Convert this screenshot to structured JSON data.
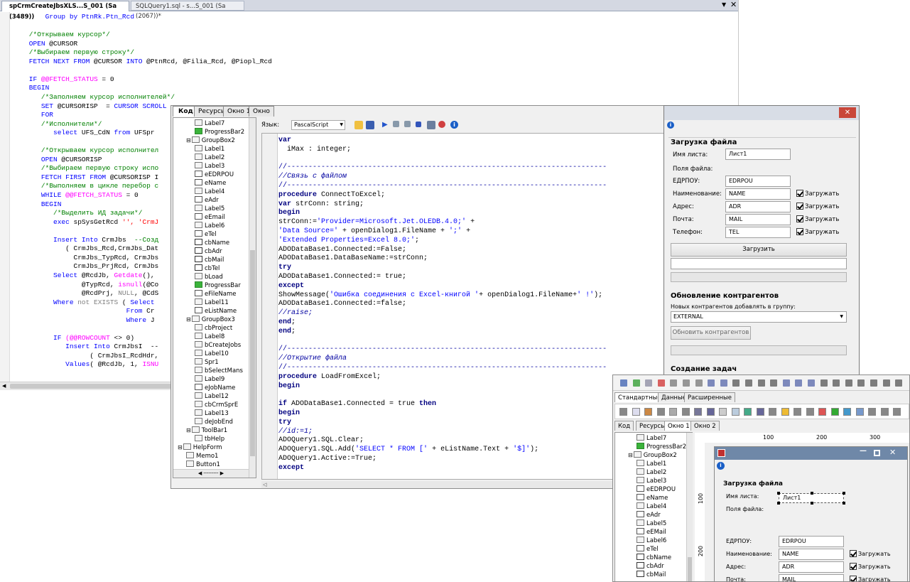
{
  "sql": {
    "tab1": "spCrmCreateJbsXLS...S_001 (Sa (3489))",
    "tab2": "SQLQuery1.sql - s...S_001 (Sa (2067))*",
    "lines": [
      [
        [
          "        Group by PtnRk.Ptn_Rcd",
          "k"
        ]
      ],
      [
        [
          "",
          ""
        ]
      ],
      [
        [
          "    /*Открываем курсор*/",
          "c"
        ]
      ],
      [
        [
          "    OPEN",
          "k"
        ],
        [
          " @CURSOR",
          "n"
        ]
      ],
      [
        [
          "    /*Выбираем первую строку*/",
          "c"
        ]
      ],
      [
        [
          "    FETCH NEXT FROM",
          "k"
        ],
        [
          " @CURSOR ",
          "n"
        ],
        [
          "INTO",
          "k"
        ],
        [
          " @PtnRcd, @Filia_Rcd, @Piopl_Rcd",
          "n"
        ]
      ],
      [
        [
          "",
          ""
        ]
      ],
      [
        [
          "    IF",
          "k"
        ],
        [
          " @@FETCH_STATUS",
          "m"
        ],
        [
          " = 0",
          "n"
        ]
      ],
      [
        [
          "    BEGIN",
          "k"
        ]
      ],
      [
        [
          "       /*Заполняем курсор исполнителей*/",
          "c"
        ]
      ],
      [
        [
          "       SET",
          "k"
        ],
        [
          " @CURSORISP  = ",
          "n"
        ],
        [
          "CURSOR SCROLL",
          "k"
        ]
      ],
      [
        [
          "       FOR",
          "k"
        ]
      ],
      [
        [
          "       /*Исполнители*/",
          "c"
        ]
      ],
      [
        [
          "          select",
          "k"
        ],
        [
          " UFS_CdN ",
          "n"
        ],
        [
          "from",
          "k"
        ],
        [
          " UFSpr",
          "n"
        ]
      ],
      [
        [
          "",
          ""
        ]
      ],
      [
        [
          "       /*Открываем курсор исполнител",
          "c"
        ]
      ],
      [
        [
          "       OPEN",
          "k"
        ],
        [
          " @CURSORISP",
          "n"
        ]
      ],
      [
        [
          "       /*Выбираем первую строку испо",
          "c"
        ]
      ],
      [
        [
          "       FETCH FIRST FROM",
          "k"
        ],
        [
          " @CURSORISP I",
          "n"
        ]
      ],
      [
        [
          "       /*Выполняем в цикле перебор с",
          "c"
        ]
      ],
      [
        [
          "       WHILE",
          "k"
        ],
        [
          " @@FETCH_STATUS",
          "m"
        ],
        [
          " = 0",
          "n"
        ]
      ],
      [
        [
          "       BEGIN",
          "k"
        ]
      ],
      [
        [
          "          /*Выделить ИД задачи*/",
          "c"
        ]
      ],
      [
        [
          "          exec",
          "k"
        ],
        [
          " spSysGetRcd ",
          "n"
        ],
        [
          "'', 'CrmJ",
          "s"
        ]
      ],
      [
        [
          "",
          ""
        ]
      ],
      [
        [
          "          Insert Into",
          "k"
        ],
        [
          " CrmJbs  ",
          "n"
        ],
        [
          "--Созд",
          "c"
        ]
      ],
      [
        [
          "             ( CrmJbs_Rcd,CrmJbs_Dat",
          "n"
        ]
      ],
      [
        [
          "               CrmJbs_TypRcd, CrmJbs",
          "n"
        ]
      ],
      [
        [
          "               CrmJbs_PrjRcd, CrmJbs",
          "n"
        ]
      ],
      [
        [
          "          Select",
          "k"
        ],
        [
          " @RcdJb, ",
          "n"
        ],
        [
          "Getdate",
          "m"
        ],
        [
          "(),",
          "n"
        ]
      ],
      [
        [
          "                 @TypRcd, ",
          "n"
        ],
        [
          "isnull",
          "m"
        ],
        [
          "(@Co",
          "n"
        ]
      ],
      [
        [
          "                 @RcdPrj, ",
          "n"
        ],
        [
          "NULL",
          "g"
        ],
        [
          ", @CdS",
          "n"
        ]
      ],
      [
        [
          "          Where",
          "k"
        ],
        [
          " not EXISTS",
          "g"
        ],
        [
          " ( ",
          "n"
        ],
        [
          "Select",
          "k"
        ]
      ],
      [
        [
          "                            From",
          "k"
        ],
        [
          " Cr",
          "n"
        ]
      ],
      [
        [
          "                            Where",
          "k"
        ],
        [
          " J",
          "n"
        ]
      ],
      [
        [
          "",
          ""
        ]
      ],
      [
        [
          "          IF",
          "k"
        ],
        [
          " (@@ROWCOUNT",
          "m"
        ],
        [
          " <> 0)",
          "n"
        ]
      ],
      [
        [
          "             Insert Into",
          "k"
        ],
        [
          " CrmJbsI  --",
          "n"
        ]
      ],
      [
        [
          "                   ( CrmJbsI_RcdHdr,",
          "n"
        ]
      ],
      [
        [
          "             Values",
          "k"
        ],
        [
          "( @RcdJb, 1, ",
          "n"
        ],
        [
          "ISNU",
          "m"
        ]
      ]
    ]
  },
  "ide": {
    "tabs": [
      "Код",
      "Ресурсы",
      "Окно 1",
      "Окно 2"
    ],
    "lang_label": "Язык:",
    "lang_value": "PascalScript",
    "tree": [
      {
        "t": "Label7",
        "d": 2,
        "i": "lbl"
      },
      {
        "t": "ProgressBar2",
        "d": 2,
        "i": "pb"
      },
      {
        "t": "GroupBox2",
        "d": 1,
        "i": "grp"
      },
      {
        "t": "Label1",
        "d": 2,
        "i": "lbl"
      },
      {
        "t": "Label2",
        "d": 2,
        "i": "lbl"
      },
      {
        "t": "Label3",
        "d": 2,
        "i": "lbl"
      },
      {
        "t": "eEDRPOU",
        "d": 2,
        "i": "ed"
      },
      {
        "t": "eName",
        "d": 2,
        "i": "ed"
      },
      {
        "t": "Label4",
        "d": 2,
        "i": "lbl"
      },
      {
        "t": "eAdr",
        "d": 2,
        "i": "ed"
      },
      {
        "t": "Label5",
        "d": 2,
        "i": "lbl"
      },
      {
        "t": "eEmail",
        "d": 2,
        "i": "ed"
      },
      {
        "t": "Label6",
        "d": 2,
        "i": "lbl"
      },
      {
        "t": "eTel",
        "d": 2,
        "i": "ed"
      },
      {
        "t": "cbName",
        "d": 2,
        "i": "cb"
      },
      {
        "t": "cbAdr",
        "d": 2,
        "i": "cb"
      },
      {
        "t": "cbMail",
        "d": 2,
        "i": "cb"
      },
      {
        "t": "cbTel",
        "d": 2,
        "i": "cb"
      },
      {
        "t": "bLoad",
        "d": 2,
        "i": "lbl"
      },
      {
        "t": "ProgressBar",
        "d": 2,
        "i": "pb"
      },
      {
        "t": "eFileName",
        "d": 2,
        "i": "ed"
      },
      {
        "t": "Label11",
        "d": 2,
        "i": "lbl"
      },
      {
        "t": "eListName",
        "d": 2,
        "i": "ed"
      },
      {
        "t": "GroupBox3",
        "d": 1,
        "i": "grp"
      },
      {
        "t": "cbProject",
        "d": 2,
        "i": "lbl"
      },
      {
        "t": "Label8",
        "d": 2,
        "i": "lbl"
      },
      {
        "t": "bCreateJobs",
        "d": 2,
        "i": "lbl"
      },
      {
        "t": "Label10",
        "d": 2,
        "i": "lbl"
      },
      {
        "t": "Spr1",
        "d": 2,
        "i": "lbl"
      },
      {
        "t": "bSelectMans",
        "d": 2,
        "i": "lbl"
      },
      {
        "t": "Label9",
        "d": 2,
        "i": "lbl"
      },
      {
        "t": "eJobName",
        "d": 2,
        "i": "ed"
      },
      {
        "t": "Label12",
        "d": 2,
        "i": "lbl"
      },
      {
        "t": "cbCrmSprE",
        "d": 2,
        "i": "lbl"
      },
      {
        "t": "Label13",
        "d": 2,
        "i": "lbl"
      },
      {
        "t": "deJobEnd",
        "d": 2,
        "i": "lbl"
      },
      {
        "t": "ToolBar1",
        "d": 1,
        "i": "grp"
      },
      {
        "t": "tbHelp",
        "d": 2,
        "i": "lbl"
      },
      {
        "t": "HelpForm",
        "d": 0,
        "i": "grp"
      },
      {
        "t": "Memo1",
        "d": 1,
        "i": "lbl"
      },
      {
        "t": "Button1",
        "d": 1,
        "i": "lbl"
      }
    ],
    "code": [
      [
        [
          "var",
          "b"
        ]
      ],
      [
        [
          "  iMax : integer;",
          "n"
        ]
      ],
      [
        [
          "",
          ""
        ]
      ],
      [
        [
          "//---------------------------------------------------------------------------",
          "c"
        ]
      ],
      [
        [
          "//Связь с файлом",
          "ci"
        ]
      ],
      [
        [
          "//---------------------------------------------------------------------------",
          "c"
        ]
      ],
      [
        [
          "procedure",
          "b"
        ],
        [
          " ConnectToExcel;",
          "n"
        ]
      ],
      [
        [
          "var",
          "b"
        ],
        [
          " strConn: string;",
          "n"
        ]
      ],
      [
        [
          "begin",
          "b"
        ]
      ],
      [
        [
          "strConn:=",
          "n"
        ],
        [
          "'Provider=Microsoft.Jet.OLEDB.4.0;'",
          "r"
        ],
        [
          " +",
          "n"
        ]
      ],
      [
        [
          "'Data Source='",
          "r"
        ],
        [
          " + openDialog1.FileName + ",
          "n"
        ],
        [
          "';'",
          "r"
        ],
        [
          " +",
          "n"
        ]
      ],
      [
        [
          "'Extended Properties=Excel 8.0;'",
          "r"
        ],
        [
          ";",
          "n"
        ]
      ],
      [
        [
          "ADODataBase1.Connected:=False;",
          "n"
        ]
      ],
      [
        [
          "ADODataBase1.DataBaseName:=strConn;",
          "n"
        ]
      ],
      [
        [
          "try",
          "b"
        ]
      ],
      [
        [
          "ADODataBase1.Connected:= true;",
          "n"
        ]
      ],
      [
        [
          "except",
          "b"
        ]
      ],
      [
        [
          "ShowMessage(",
          "n"
        ],
        [
          "'Ошибка соединения с Excel-книгой '",
          "r"
        ],
        [
          "+ openDialog1.FileName+",
          "n"
        ],
        [
          "' !'",
          "r"
        ],
        [
          ");",
          "n"
        ]
      ],
      [
        [
          "ADODataBase1.Connected:=false;",
          "n"
        ]
      ],
      [
        [
          "//raise;",
          "ci"
        ]
      ],
      [
        [
          "end",
          "b"
        ],
        [
          ";",
          "n"
        ]
      ],
      [
        [
          "end",
          "b"
        ],
        [
          ";",
          "n"
        ]
      ],
      [
        [
          "",
          ""
        ]
      ],
      [
        [
          "//---------------------------------------------------------------------------",
          "c"
        ]
      ],
      [
        [
          "//Открытие файла",
          "ci"
        ]
      ],
      [
        [
          "//---------------------------------------------------------------------------",
          "c"
        ]
      ],
      [
        [
          "procedure",
          "b"
        ],
        [
          " LoadFromExcel;",
          "n"
        ]
      ],
      [
        [
          "begin",
          "b"
        ]
      ],
      [
        [
          "",
          ""
        ]
      ],
      [
        [
          "if",
          "b"
        ],
        [
          " ADODataBase1.Connected = true ",
          "n"
        ],
        [
          "then",
          "b"
        ]
      ],
      [
        [
          "begin",
          "b"
        ]
      ],
      [
        [
          "try",
          "b"
        ]
      ],
      [
        [
          "//id:=1;",
          "ci"
        ]
      ],
      [
        [
          "ADOQuery1.SQL.Clear;",
          "n"
        ]
      ],
      [
        [
          "ADOQuery1.SQL.Add(",
          "n"
        ],
        [
          "'SELECT * FROM ['",
          "r"
        ],
        [
          " + eListName.Text + ",
          "n"
        ],
        [
          "'$]'",
          "r"
        ],
        [
          ");",
          "n"
        ]
      ],
      [
        [
          "ADOQuery1.Active:=True;",
          "n"
        ]
      ],
      [
        [
          "except",
          "b"
        ]
      ]
    ]
  },
  "form": {
    "title": "Загрузка файла",
    "sheet_label": "Имя листа:",
    "sheet_value": "Лист1",
    "fields_label": "Поля файла:",
    "rows": [
      {
        "label": "ЕДРПОУ:",
        "value": "EDRPOU",
        "check": ""
      },
      {
        "label": "Наименование:",
        "value": "NAME",
        "check": "Загружать"
      },
      {
        "label": "Адрес:",
        "value": "ADR",
        "check": "Загружать"
      },
      {
        "label": "Почта:",
        "value": "MAIL",
        "check": "Загружать"
      },
      {
        "label": "Телефон:",
        "value": "TEL",
        "check": "Загружать"
      }
    ],
    "load_button": "Загрузить",
    "update_title": "Обновление контрагентов",
    "group_label": "Новых контрагентов добавлять в группу:",
    "group_value": "EXTERNAL",
    "update_button": "Обновить контрагентов",
    "create_title": "Создание задач"
  },
  "designer": {
    "palette_tabs": [
      "Стандартные",
      "Данные",
      "Расширенные"
    ],
    "tabs": [
      "Код",
      "Ресурсы",
      "Окно 1",
      "Окно 2"
    ],
    "ruler": [
      "100",
      "200",
      "300"
    ],
    "vruler": [
      "100",
      "200"
    ],
    "tree": [
      {
        "t": "Label7",
        "d": 2,
        "i": "lbl"
      },
      {
        "t": "ProgressBar2",
        "d": 2,
        "i": "pb"
      },
      {
        "t": "GroupBox2",
        "d": 1,
        "i": "grp"
      },
      {
        "t": "Label1",
        "d": 2,
        "i": "lbl"
      },
      {
        "t": "Label2",
        "d": 2,
        "i": "lbl"
      },
      {
        "t": "Label3",
        "d": 2,
        "i": "lbl"
      },
      {
        "t": "eEDRPOU",
        "d": 2,
        "i": "ed"
      },
      {
        "t": "eName",
        "d": 2,
        "i": "ed"
      },
      {
        "t": "Label4",
        "d": 2,
        "i": "lbl"
      },
      {
        "t": "eAdr",
        "d": 2,
        "i": "ed"
      },
      {
        "t": "Label5",
        "d": 2,
        "i": "lbl"
      },
      {
        "t": "eEMail",
        "d": 2,
        "i": "ed"
      },
      {
        "t": "Label6",
        "d": 2,
        "i": "lbl"
      },
      {
        "t": "eTel",
        "d": 2,
        "i": "ed"
      },
      {
        "t": "cbName",
        "d": 2,
        "i": "cb"
      },
      {
        "t": "cbAdr",
        "d": 2,
        "i": "cb"
      },
      {
        "t": "cbMail",
        "d": 2,
        "i": "cb"
      }
    ]
  }
}
